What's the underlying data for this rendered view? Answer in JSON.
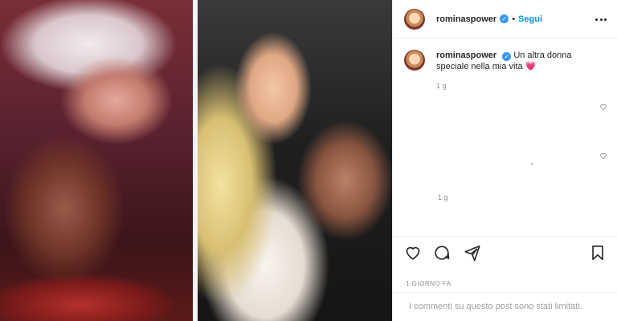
{
  "post": {
    "images": [
      {
        "alt": "",
        "icon": "photo-left"
      },
      {
        "alt": "",
        "icon": "photo-right"
      }
    ]
  },
  "header": {
    "username": "rominaspower",
    "verified_glyph": "✓",
    "separator": "•",
    "follow_label": "Segui",
    "more_icon": "more-horizontal-icon"
  },
  "caption": {
    "username": "rominaspower",
    "text": "Un altra donna speciale nella mia vita",
    "emoji": "💗",
    "time": "1 g"
  },
  "comments_area": {
    "stray_time": "1 g"
  },
  "actions": {
    "icons": [
      "heart-icon",
      "comment-icon",
      "share-icon",
      "bookmark-icon"
    ]
  },
  "post_date": "1 GIORNO FA",
  "comments_limited": "I commenti su questo post sono stati limitati.",
  "colors": {
    "link_blue": "#0095f6",
    "verified_blue": "#3897f0",
    "muted_text": "#8e8e8e",
    "border": "#efefef",
    "emoji_pink": "#ff4fa3"
  }
}
